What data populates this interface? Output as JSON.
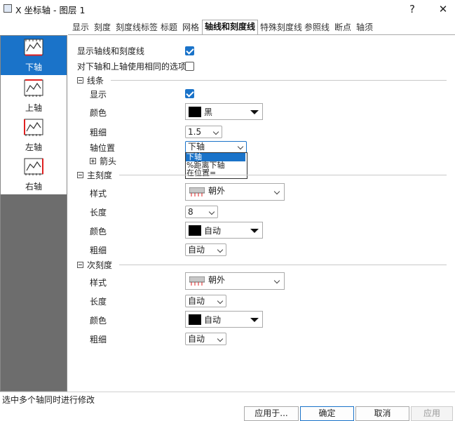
{
  "window": {
    "title": "X 坐标轴 - 图层 1",
    "help_label": "?",
    "close_label": "✕"
  },
  "tabs": [
    {
      "label": "显示"
    },
    {
      "label": "刻度"
    },
    {
      "label": "刻度线标签"
    },
    {
      "label": "标题"
    },
    {
      "label": "网格"
    },
    {
      "label": "轴线和刻度线",
      "active": true
    },
    {
      "label": "特殊刻度线"
    },
    {
      "label": "参照线"
    },
    {
      "label": "断点"
    },
    {
      "label": "轴须"
    }
  ],
  "axes_panel": {
    "selected": "下轴",
    "items": [
      {
        "label": "下轴"
      },
      {
        "label": "上轴"
      },
      {
        "label": "左轴"
      },
      {
        "label": "右轴"
      }
    ]
  },
  "top_options": {
    "show_axes_ticks_label": "显示轴线和刻度线",
    "show_axes_ticks_checked": true,
    "same_options_label": "对下轴和上轴使用相同的选项",
    "same_options_checked": false
  },
  "line_section": {
    "title": "线条",
    "show_label": "显示",
    "show_checked": true,
    "color_label": "颜色",
    "color_value": "黑",
    "thickness_label": "粗细",
    "thickness_value": "1.5",
    "position_label": "轴位置",
    "position_value": "下轴",
    "position_options": [
      "下轴",
      "%距离下轴",
      "在位置="
    ],
    "arrow_label": "箭头"
  },
  "major_ticks": {
    "title": "主刻度",
    "style_label": "样式",
    "style_value": "朝外",
    "length_label": "长度",
    "length_value": "8",
    "color_label": "颜色",
    "color_value": "自动",
    "thickness_label": "粗细",
    "thickness_value": "自动"
  },
  "minor_ticks": {
    "title": "次刻度",
    "style_label": "样式",
    "style_value": "朝外",
    "length_label": "长度",
    "length_value": "自动",
    "color_label": "颜色",
    "color_value": "自动",
    "thickness_label": "粗细",
    "thickness_value": "自动"
  },
  "status_text": "选中多个轴同时进行修改",
  "buttons": {
    "apply_to": "应用于...",
    "ok": "确定",
    "cancel": "取消",
    "apply": "应用"
  },
  "colors": {
    "accent": "#1a73c9",
    "panel_gray": "#6d6d6d",
    "swatch_black": "#000000"
  }
}
